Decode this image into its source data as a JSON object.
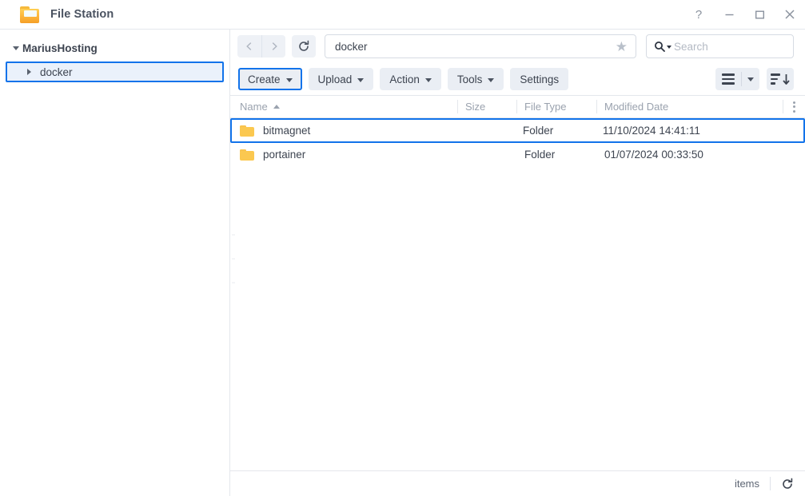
{
  "window": {
    "title": "File Station",
    "app_icon": "folder-icon",
    "controls": {
      "help": "?",
      "minimize": "minimize-icon",
      "maximize": "maximize-icon",
      "close": "close-icon"
    }
  },
  "sidebar": {
    "root": {
      "label": "MariusHosting",
      "expanded": true
    },
    "items": [
      {
        "label": "docker",
        "expanded": false,
        "selected": true
      }
    ]
  },
  "nav": {
    "back": "back-icon",
    "forward": "forward-icon",
    "refresh": "refresh-icon",
    "path_value": "docker",
    "favorite": "★",
    "search_placeholder": "Search",
    "search_value": ""
  },
  "toolbar": {
    "buttons": [
      {
        "label": "Create",
        "has_dropdown": true,
        "selected": true
      },
      {
        "label": "Upload",
        "has_dropdown": true,
        "selected": false
      },
      {
        "label": "Action",
        "has_dropdown": true,
        "selected": false
      },
      {
        "label": "Tools",
        "has_dropdown": true,
        "selected": false
      },
      {
        "label": "Settings",
        "has_dropdown": false,
        "selected": false
      }
    ],
    "view_button": "list-view-icon",
    "sort_button": "sort-descending-icon"
  },
  "file_list": {
    "columns": [
      {
        "key": "name",
        "label": "Name",
        "sort": "asc"
      },
      {
        "key": "size",
        "label": "Size",
        "sort": ""
      },
      {
        "key": "type",
        "label": "File Type",
        "sort": ""
      },
      {
        "key": "date",
        "label": "Modified Date",
        "sort": ""
      }
    ],
    "column_menu": "kebab-menu-icon",
    "rows": [
      {
        "icon": "folder-icon",
        "name": "bitmagnet",
        "size": "",
        "type": "Folder",
        "date": "11/10/2024 14:41:11",
        "selected": true
      },
      {
        "icon": "folder-icon",
        "name": "portainer",
        "size": "",
        "type": "Folder",
        "date": "01/07/2024 00:33:50",
        "selected": false
      }
    ]
  },
  "statusbar": {
    "items_label": "items",
    "refresh": "refresh-icon"
  },
  "colors": {
    "accent": "#1273ea",
    "folder": "#fbc850",
    "toolbar_button_bg": "#eaeef4",
    "text": "#3d4450",
    "muted_text": "#9aa2ae"
  }
}
